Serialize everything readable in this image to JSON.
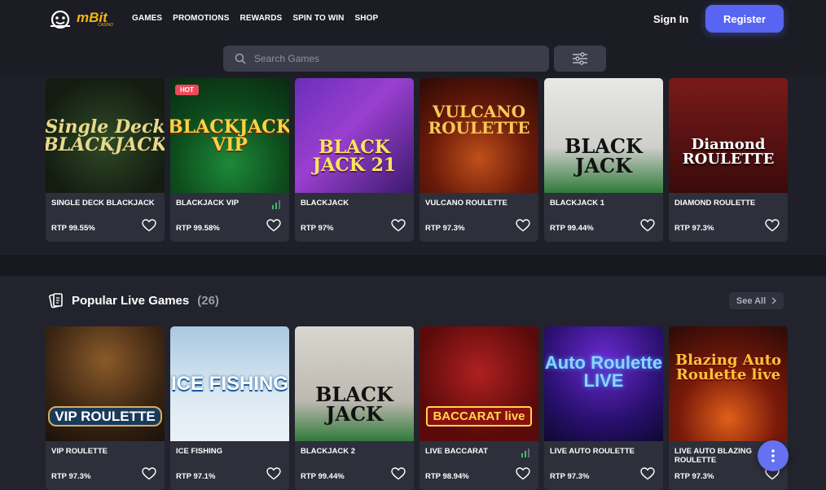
{
  "header": {
    "logo_text": "mBit",
    "logo_sub": "CASINO",
    "nav": [
      "GAMES",
      "PROMOTIONS",
      "REWARDS",
      "SPIN TO WIN",
      "SHOP"
    ],
    "signin": "Sign In",
    "register": "Register",
    "search_placeholder": "Search Games"
  },
  "row1": [
    {
      "name": "SINGLE DECK BLACKJACK",
      "rtp": "RTP 99.55%",
      "art": "Single Deck BLACKJACK"
    },
    {
      "name": "BLACKJACK VIP",
      "rtp": "RTP 99.58%",
      "art": "BLACKJACK VIP",
      "badge": "HOT"
    },
    {
      "name": "BLACKJACK",
      "rtp": "RTP 97%",
      "art": "BLACK JACK 21"
    },
    {
      "name": "VULCANO ROULETTE",
      "rtp": "RTP 97.3%",
      "art": "VULCANO ROULETTE"
    },
    {
      "name": "BLACKJACK 1",
      "rtp": "RTP 99.44%",
      "art": "BLACK JACK"
    },
    {
      "name": "DIAMOND ROULETTE",
      "rtp": "RTP 97.3%",
      "art": "Diamond ROULETTE"
    }
  ],
  "section": {
    "title": "Popular Live Games",
    "count": "(26)",
    "see_all": "See All"
  },
  "row2": [
    {
      "name": "VIP ROULETTE",
      "rtp": "RTP 97.3%",
      "art": "VIP ROULETTE"
    },
    {
      "name": "ICE FISHING",
      "rtp": "RTP 97.1%",
      "art": "ICE FISHING"
    },
    {
      "name": "BLACKJACK 2",
      "rtp": "RTP 99.44%",
      "art": "BLACK JACK"
    },
    {
      "name": "LIVE BACCARAT",
      "rtp": "RTP 98.94%",
      "art": "BACCARAT live"
    },
    {
      "name": "LIVE AUTO ROULETTE",
      "rtp": "RTP 97.3%",
      "art": "Auto Roulette LIVE"
    },
    {
      "name": "LIVE AUTO BLAZING ROULETTE",
      "rtp": "RTP 97.3%",
      "art": "Blazing Auto Roulette live"
    }
  ]
}
